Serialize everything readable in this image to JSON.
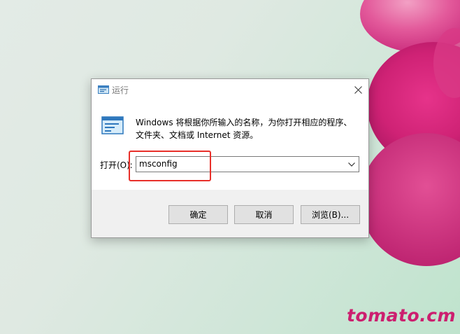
{
  "dialog": {
    "title": "运行",
    "description_line1": "Windows 将根据你所输入的名称，为你打开相应的程序、",
    "description_line2": "文件夹、文档或 Internet 资源。",
    "open_label": "打开(O):",
    "open_value": "msconfig",
    "ok_label": "确定",
    "cancel_label": "取消",
    "browse_label": "浏览(B)..."
  },
  "watermark": "tomato.cm",
  "colors": {
    "highlight": "#e8302a",
    "watermark": "#cc1f6f",
    "button_bg": "#e1e1e1",
    "button_area_bg": "#f0f0f0"
  },
  "icons": {
    "title": "run-icon",
    "large": "run-icon",
    "close": "close-icon",
    "dropdown": "chevron-down-icon"
  }
}
